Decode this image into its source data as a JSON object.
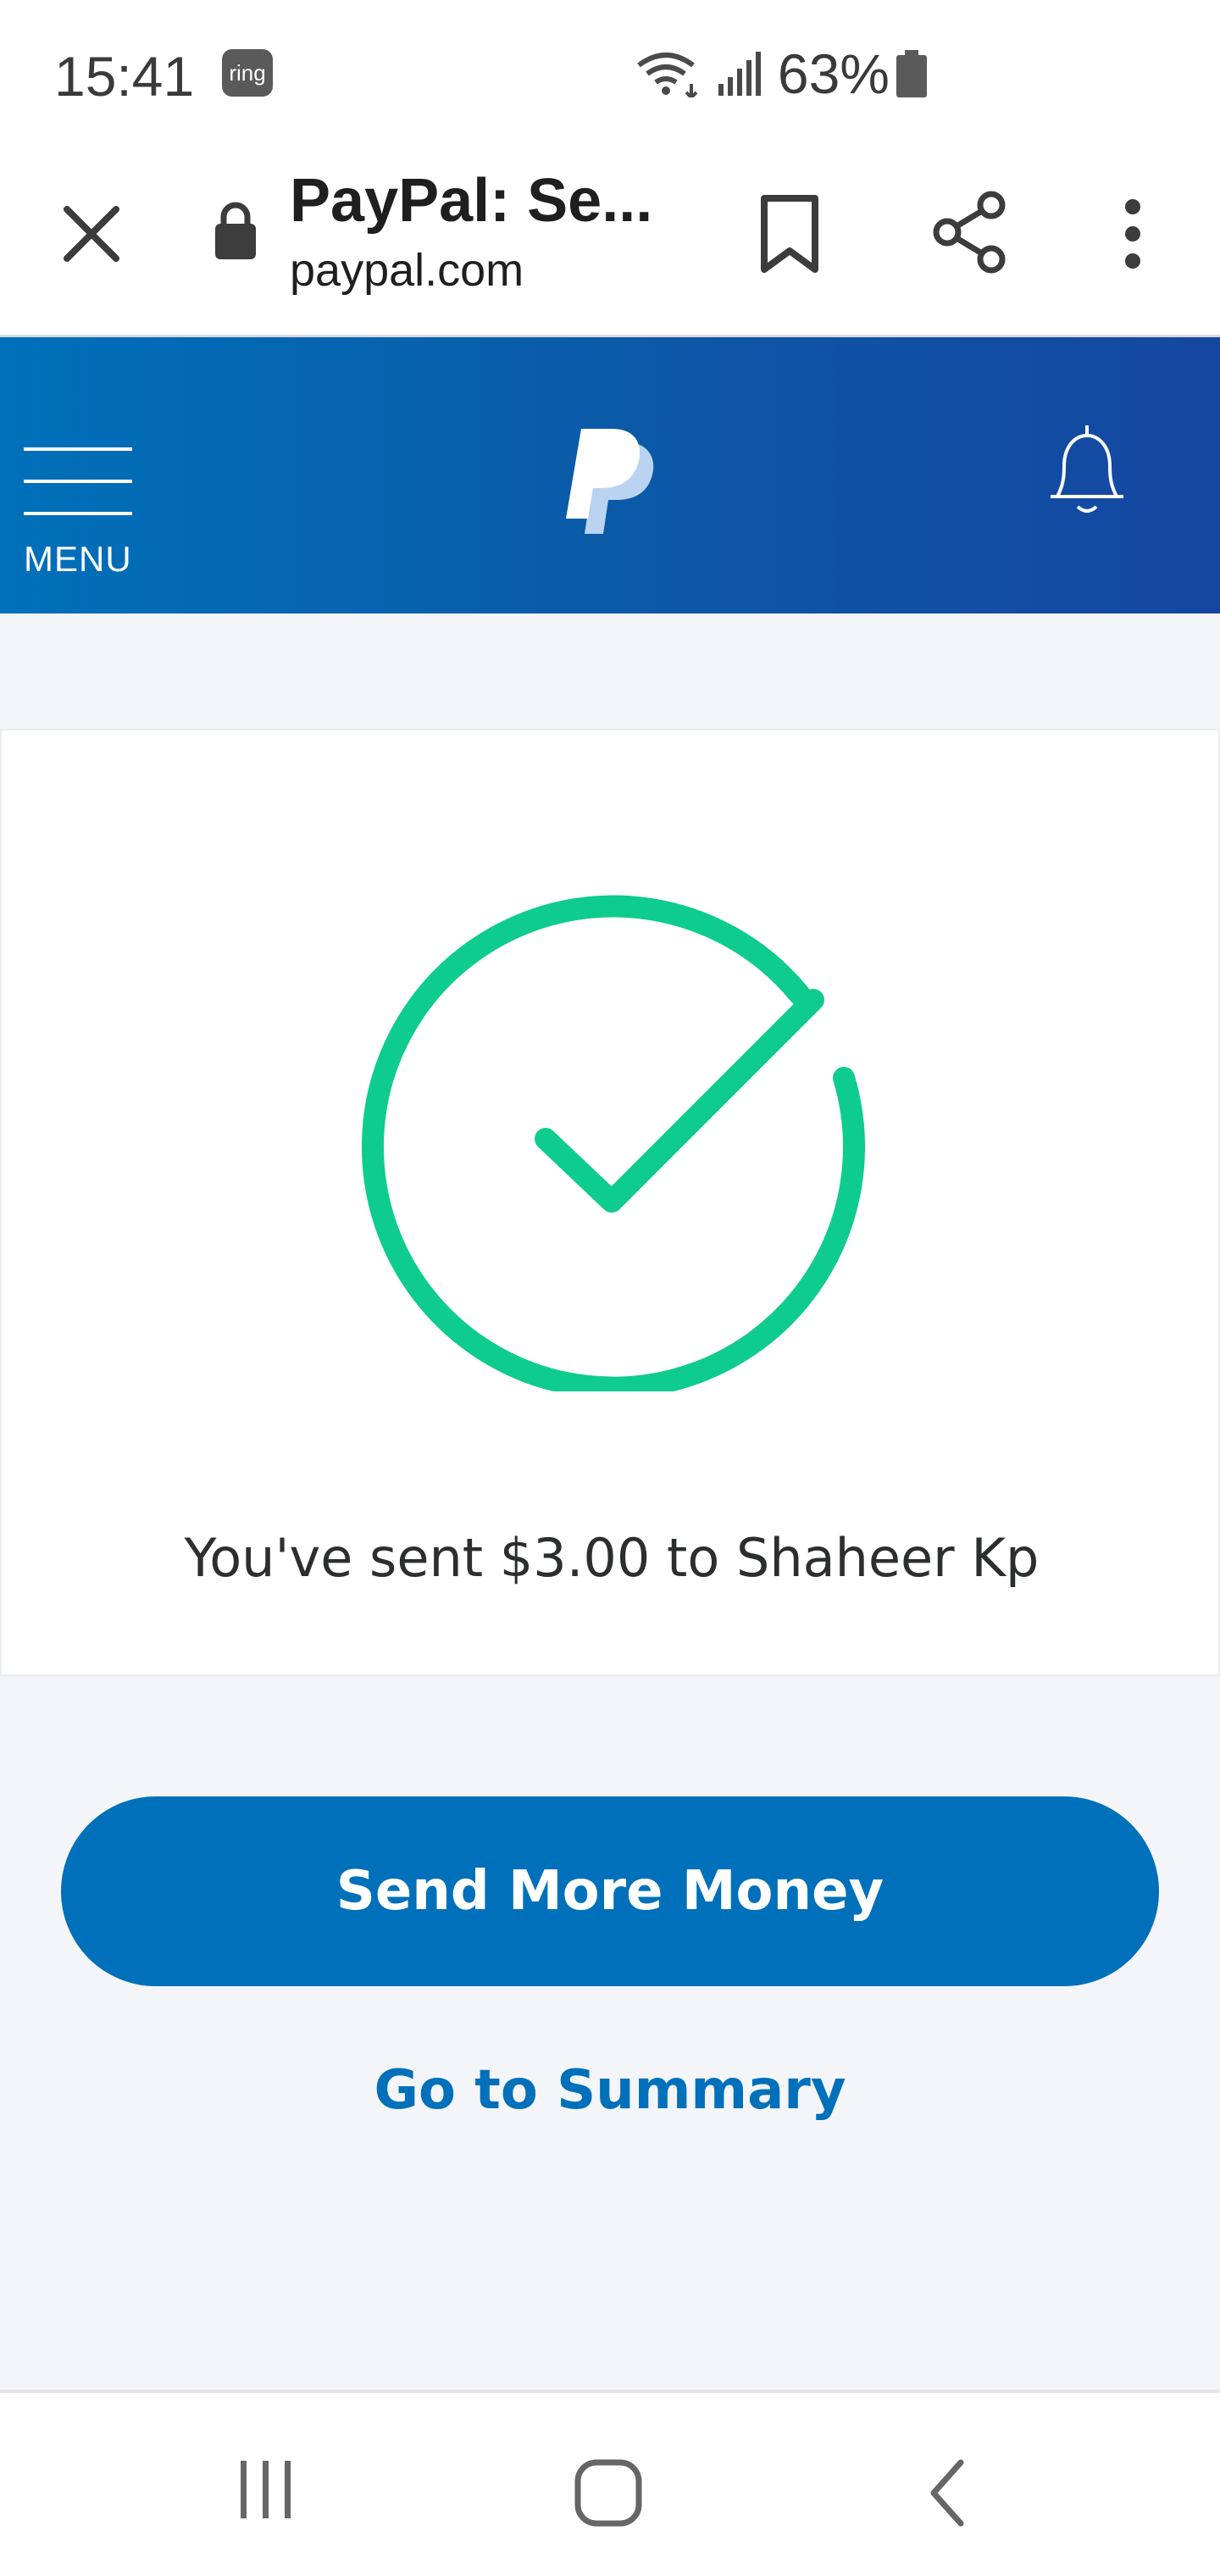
{
  "status_bar": {
    "time": "15:41",
    "ring_badge": "ring",
    "battery": "63%"
  },
  "browser": {
    "tab_title": "PayPal: Se...",
    "url": "paypal.com",
    "icons": [
      "close-icon",
      "lock-icon",
      "bookmark-icon",
      "share-icon",
      "more-vert-icon"
    ]
  },
  "header": {
    "menu_label": "MENU",
    "logo": "paypal-logo",
    "bell": "bell-icon",
    "colors": {
      "gradient_start": "#0070ba",
      "gradient_end": "#1546a0"
    }
  },
  "confirmation": {
    "message": "You've sent $3.00 to Shaheer Kp",
    "check_color": "#0ecc8e"
  },
  "actions": {
    "primary_label": "Send More Money",
    "secondary_label": "Go to Summary",
    "accent": "#0070ba"
  },
  "nav_bar": {
    "icons": [
      "recents-icon",
      "home-icon",
      "back-icon"
    ]
  }
}
